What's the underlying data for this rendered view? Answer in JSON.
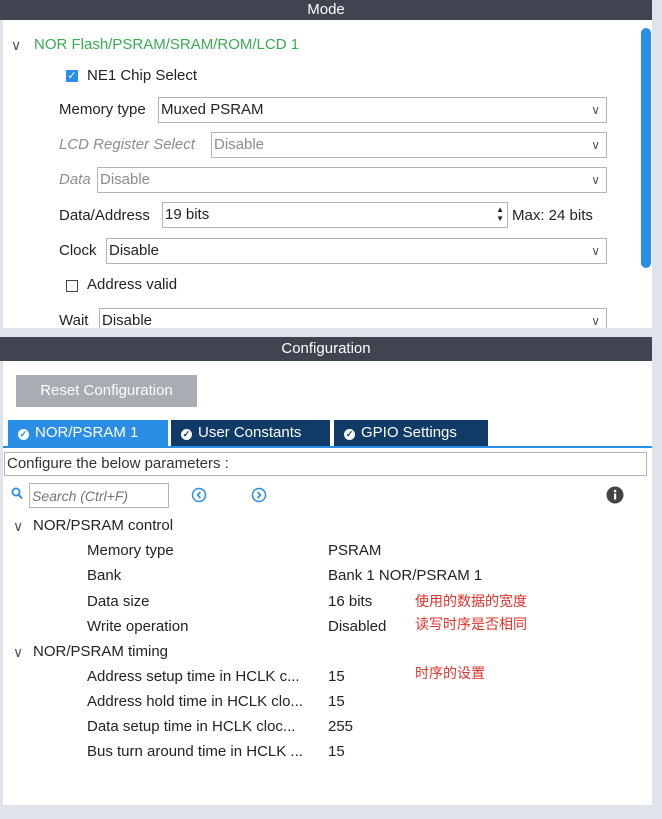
{
  "mode": {
    "header": "Mode",
    "tree_title": "NOR Flash/PSRAM/SRAM/ROM/LCD 1",
    "chip_select_label": "NE1 Chip Select",
    "chip_select_checked": true,
    "memory_type": {
      "label": "Memory type",
      "value": "Muxed PSRAM"
    },
    "lcd_register_select": {
      "label": "LCD Register Select",
      "value": "Disable"
    },
    "data": {
      "label": "Data",
      "value": "Disable"
    },
    "data_address": {
      "label": "Data/Address",
      "value": "19 bits",
      "max": "Max: 24 bits"
    },
    "clock": {
      "label": "Clock",
      "value": "Disable"
    },
    "address_valid_label": "Address valid",
    "address_valid_checked": false,
    "wait": {
      "label": "Wait",
      "value": "Disable"
    }
  },
  "config": {
    "header": "Configuration",
    "reset_button": "Reset Configuration",
    "tabs": [
      {
        "label": "NOR/PSRAM 1",
        "active": true
      },
      {
        "label": "User Constants",
        "active": false
      },
      {
        "label": "GPIO Settings",
        "active": false
      }
    ],
    "instructions": "Configure the below parameters :",
    "search_placeholder": "Search (Ctrl+F)",
    "groups": [
      {
        "title": "NOR/PSRAM control",
        "rows": [
          {
            "name": "Memory type",
            "value": "PSRAM"
          },
          {
            "name": "Bank",
            "value": "Bank 1 NOR/PSRAM 1"
          },
          {
            "name": "Data size",
            "value": "16 bits"
          },
          {
            "name": "Write operation",
            "value": "Disabled"
          }
        ]
      },
      {
        "title": "NOR/PSRAM timing",
        "rows": [
          {
            "name": "Address setup time in HCLK c...",
            "value": "15"
          },
          {
            "name": "Address hold time in HCLK clo...",
            "value": "15"
          },
          {
            "name": "Data setup time in HCLK cloc...",
            "value": "255"
          },
          {
            "name": "Bus turn around time in HCLK ...",
            "value": "15"
          }
        ]
      }
    ],
    "notes": [
      "使用的数据的宽度",
      "读写时序是否相同",
      "时序的设置"
    ]
  },
  "colors": {
    "header_bg": "#3f4450",
    "accent_blue": "#2a8ee6",
    "tab_dark": "#0f3b66",
    "tree_green": "#3aab52",
    "note_red": "#e0322b"
  }
}
